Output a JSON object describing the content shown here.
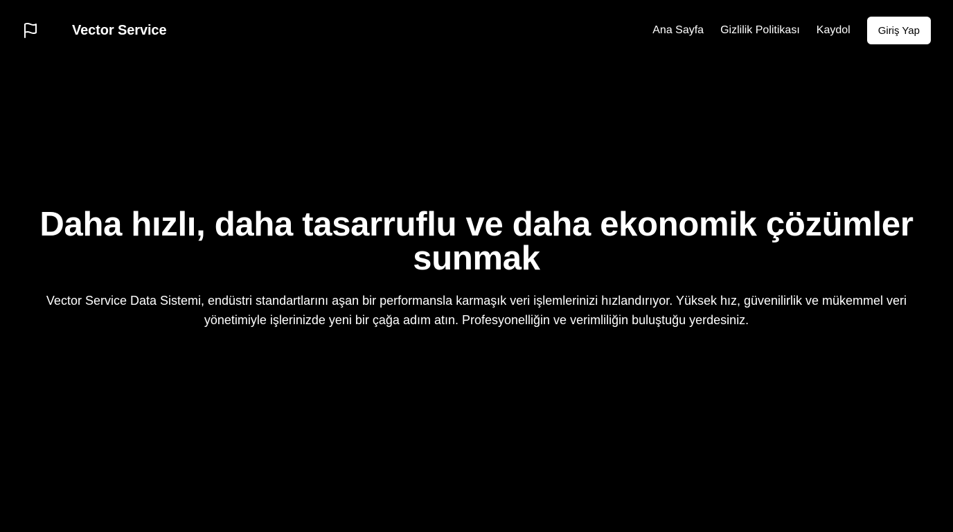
{
  "header": {
    "brand_icon": "flag-icon",
    "brand_name": "Vector Service",
    "nav": {
      "home": "Ana Sayfa",
      "privacy": "Gizlilik Politikası",
      "register": "Kaydol",
      "login": "Giriş Yap"
    }
  },
  "hero": {
    "title": "Daha hızlı, daha tasarruflu ve daha ekonomik çözümler sunmak",
    "subtitle": "Vector Service Data Sistemi, endüstri standartlarını aşan bir performansla karmaşık veri işlemlerinizi hızlandırıyor. Yüksek hız, güvenilirlik ve mükemmel veri yönetimiyle işlerinizde yeni bir çağa adım atın. Profesyonelliğin ve verimliliğin buluştuğu yerdesiniz."
  },
  "colors": {
    "background": "#000000",
    "text": "#ffffff",
    "button_bg": "#ffffff",
    "button_text": "#000000"
  }
}
